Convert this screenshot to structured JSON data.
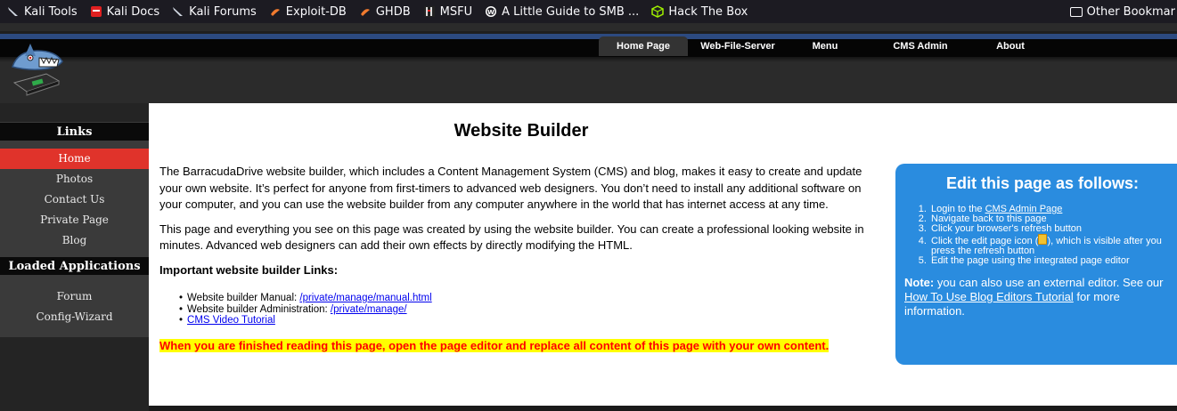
{
  "bookmarks": {
    "items": [
      {
        "label": "Kali Tools",
        "icon": "kali-dragon-icon"
      },
      {
        "label": "Kali Docs",
        "icon": "kali-docs-icon"
      },
      {
        "label": "Kali Forums",
        "icon": "kali-dragon-icon"
      },
      {
        "label": "Exploit-DB",
        "icon": "exploitdb-icon"
      },
      {
        "label": "GHDB",
        "icon": "ghdb-icon"
      },
      {
        "label": "MSFU",
        "icon": "msfu-icon"
      },
      {
        "label": "A Little Guide to SMB ...",
        "icon": "wordpress-icon"
      },
      {
        "label": "Hack The Box",
        "icon": "hackthebox-icon"
      }
    ],
    "other_label": "Other Bookmar"
  },
  "topnav": {
    "items": [
      {
        "label": "Home Page",
        "active": true
      },
      {
        "label": "Web-File-Server",
        "active": false
      },
      {
        "label": "Menu",
        "active": false
      },
      {
        "label": "CMS Admin",
        "active": false
      },
      {
        "label": "About",
        "active": false
      }
    ]
  },
  "sidebar": {
    "links_heading": "Links",
    "links": [
      "Home",
      "Photos",
      "Contact Us",
      "Private Page",
      "Blog"
    ],
    "apps_heading": "Loaded Applications",
    "apps": [
      "Forum",
      "Config-Wizard"
    ]
  },
  "main": {
    "title": "Website Builder",
    "p1": "The BarracudaDrive website builder, which includes a Content Management System (CMS) and blog, makes it easy to create and update your own website. It’s perfect for anyone from first-timers to advanced web designers. You don’t need to install any additional software on your computer, and you can use the website builder from any computer anywhere in the world that has internet access at any time.",
    "p2": "This page and everything you see on this page was created by using the website builder. You can create a professional looking website in minutes. Advanced web designers can add their own effects by directly modifying the HTML.",
    "links_heading": "Important website builder Links:",
    "link1_prefix": "Website builder Manual: ",
    "link1_text": "/private/manage/manual.html",
    "link2_prefix": "Website builder Administration: ",
    "link2_text": "/private/manage/",
    "link3_text": "CMS Video Tutorial",
    "notice": "When you are finished reading this page, open the page editor and replace all content of this page with your own content."
  },
  "bluebox": {
    "heading": "Edit this page as follows:",
    "step1_prefix": "Login to the ",
    "step1_link": "CMS Admin Page",
    "step2": "Navigate back to this page",
    "step3": "Click your browser's refresh button",
    "step4_prefix": "Click the edit page icon (",
    "step4_suffix": "), which is visible after you press the refresh button",
    "step5": "Edit the page using the integrated page editor",
    "note_label": "Note:",
    "note_prefix": " you can also use an external editor. See our ",
    "note_link": "How To Use Blog Editors Tutorial",
    "note_suffix": " for more information."
  },
  "colors": {
    "accent_blue": "#2a8cdf",
    "active_red": "#e0332b",
    "notice_yellow": "#ffff00",
    "notice_red": "#ff0000"
  }
}
